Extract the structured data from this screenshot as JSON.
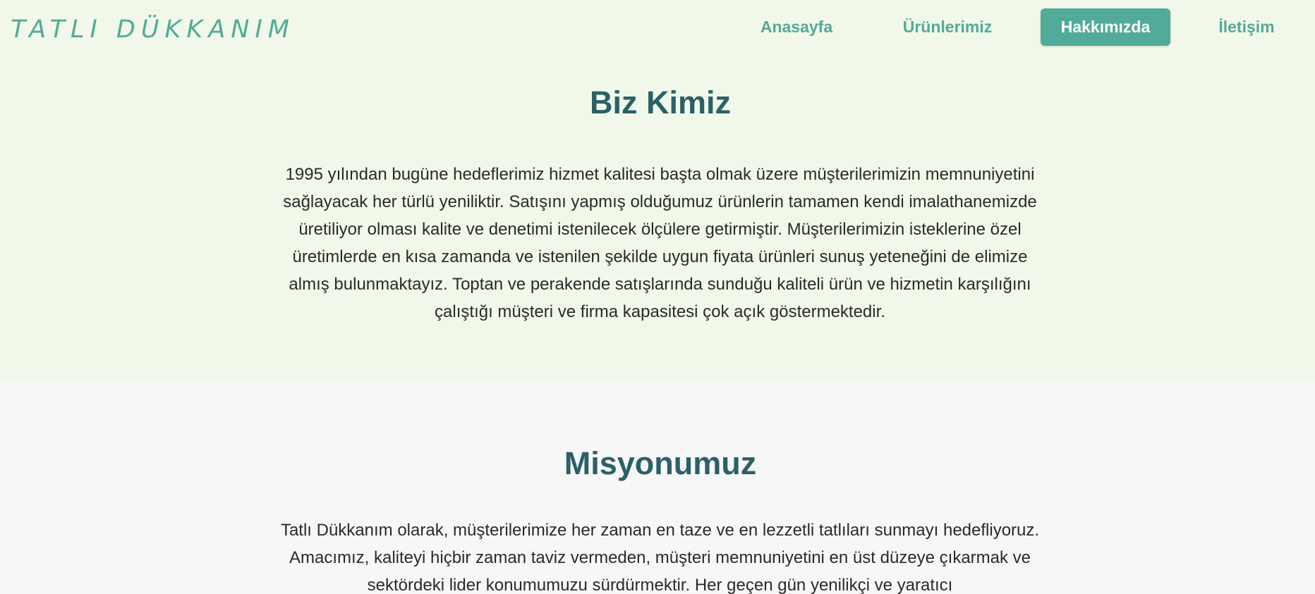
{
  "brand": {
    "name": "TATLI DÜKKANIM"
  },
  "nav": {
    "items": [
      {
        "label": "Anasayfa",
        "active": false
      },
      {
        "label": "Ürünlerimiz",
        "active": false
      },
      {
        "label": "Hakkımızda",
        "active": true
      },
      {
        "label": "İletişim",
        "active": false
      }
    ]
  },
  "sections": {
    "who_we_are": {
      "title": "Biz Kimiz",
      "text": "1995 yılından bugüne hedeflerimiz hizmet kalitesi başta olmak üzere müşterilerimizin memnuniyetini sağlayacak her türlü yeniliktir. Satışını yapmış olduğumuz ürünlerin tamamen kendi imalathanemizde üretiliyor olması kalite ve denetimi istenilecek ölçülere getirmiştir. Müşterilerimizin isteklerine özel üretimlerde en kısa zamanda ve istenilen şekilde uygun fiyata ürünleri sunuş yeteneğini de elimize almış bulunmaktayız. Toptan ve perakende satışlarında sunduğu kaliteli ürün ve hizmetin karşılığını çalıştığı müşteri ve firma kapasitesi çok açık göstermektedir."
    },
    "mission": {
      "title": "Misyonumuz",
      "text": "Tatlı Dükkanım olarak, müşterilerimize her zaman en taze ve en lezzetli tatlıları sunmayı hedefliyoruz. Amacımız, kaliteyi hiçbir zaman taviz vermeden, müşteri memnuniyetini en üst düzeye çıkarmak ve sektördeki lider konumumuzu sürdürmektir. Her geçen gün yenilikçi ve yaratıcı"
    }
  },
  "colors": {
    "accent": "#52ab98",
    "heading": "#2b6067",
    "top_background": "#f1f8e9",
    "bottom_background": "#f7f7f7"
  }
}
